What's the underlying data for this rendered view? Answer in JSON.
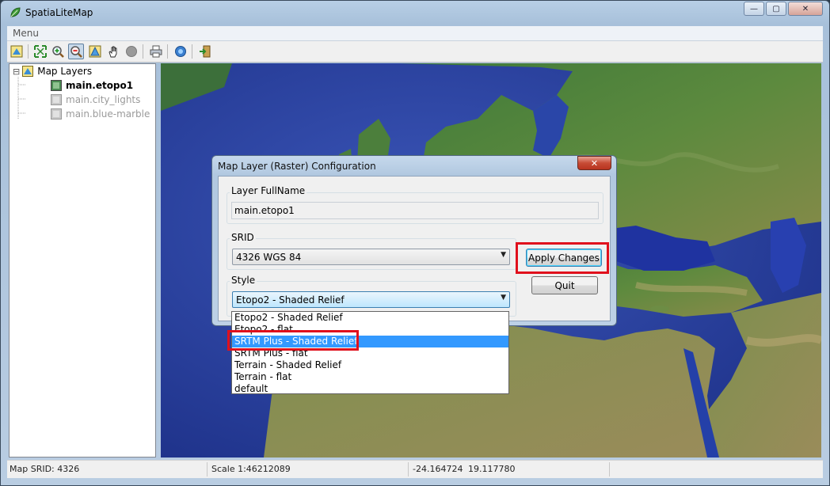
{
  "window": {
    "title": "SpatiaLiteMap",
    "minimize_glyph": "—",
    "maximize_glyph": "▢",
    "close_glyph": "✕"
  },
  "menu": {
    "label": "Menu"
  },
  "toolbar": {
    "buttons": [
      {
        "name": "layer-icon"
      },
      {
        "name": "zoom-full-icon"
      },
      {
        "name": "zoom-in-icon"
      },
      {
        "name": "zoom-out-icon"
      },
      {
        "name": "identify-icon"
      },
      {
        "name": "pan-hand-icon"
      },
      {
        "name": "stop-icon"
      },
      {
        "name": "print-icon"
      },
      {
        "name": "info-icon"
      },
      {
        "name": "exit-icon"
      }
    ]
  },
  "tree": {
    "root_label": "Map Layers",
    "expander": "⊟",
    "layers": [
      {
        "label": "main.etopo1",
        "active": true
      },
      {
        "label": "main.city_lights",
        "active": false
      },
      {
        "label": "main.blue-marble",
        "active": false
      }
    ]
  },
  "status": {
    "srid": "Map SRID: 4326",
    "scale": "Scale 1:46212089",
    "x": "-24.164724",
    "y": "19.117780"
  },
  "dialog": {
    "title": "Map Layer (Raster) Configuration",
    "close_glyph": "✕",
    "fullname_group": "Layer FullName",
    "fullname_value": "main.etopo1",
    "srid_group": "SRID",
    "srid_value": "4326 WGS 84",
    "style_group": "Style",
    "style_value": "Etopo2 - Shaded Relief",
    "apply_label": "Apply Changes",
    "quit_label": "Quit",
    "dropdown_arrow": "▼",
    "style_options": [
      "Etopo2 - Shaded Relief",
      "Etopo2 - flat",
      "SRTM Plus - Shaded Relief",
      "SRTM Plus - flat",
      "Terrain - Shaded Relief",
      "Terrain - flat",
      "default"
    ],
    "hovered_option": "SRTM Plus - Shaded Relief"
  },
  "colors": {
    "highlight": "#e0101c",
    "selection": "#3399ff",
    "sea": "#223c9a",
    "land": "#4f7a35"
  }
}
